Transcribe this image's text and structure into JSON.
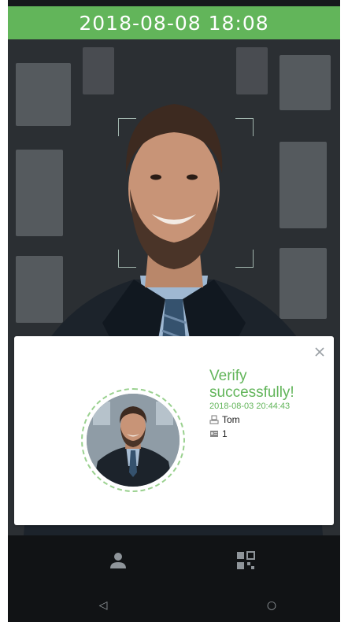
{
  "header": {
    "datetime": "2018-08-08 18:08"
  },
  "popup": {
    "title_line1": "Verify",
    "title_line2": "successfully!",
    "timestamp": "2018-08-03 20:44:43",
    "user_name": "Tom",
    "user_id": "1",
    "close_icon": "close-icon"
  },
  "bottom": {
    "icons": [
      "user-icon",
      "qr-code-icon"
    ],
    "nav": {
      "back": "◁",
      "home": "○"
    }
  },
  "colors": {
    "accent": "#62b55a",
    "background": "#16191c",
    "popup": "#ffffff"
  }
}
